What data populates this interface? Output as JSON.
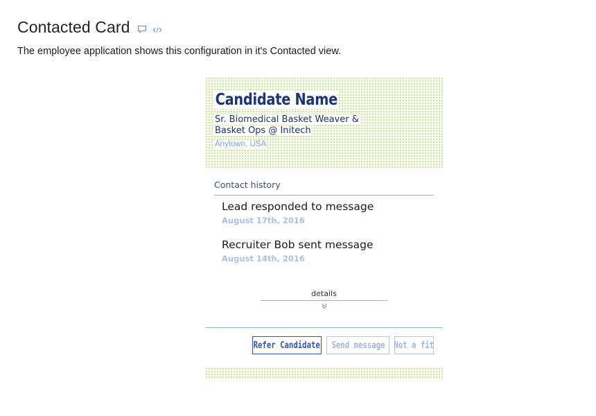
{
  "header": {
    "title": "Contacted Card",
    "comment_icon": "speech-bubble-icon",
    "code_icon": "code-brackets-icon"
  },
  "description": "The employee application shows this configuration in it's Contacted view.",
  "card": {
    "candidate_name": "Candidate Name",
    "candidate_title": "Sr. Biomedical Basket Weaver & Basket Ops @ Initech",
    "candidate_location": "Anytown, USA",
    "history_label": "Contact history",
    "events": [
      {
        "text": "Lead responded to message",
        "date": "August 17th, 2016"
      },
      {
        "text": "Recruiter Bob sent message",
        "date": "August 14th, 2016"
      }
    ],
    "details_label": "details",
    "details_icon": "double-chevron-down-icon",
    "actions": {
      "refer": "Refer Candidate",
      "send": "Send message",
      "not_fit": "Not a fit"
    }
  },
  "colors": {
    "accent": "#2c55c0",
    "name_text": "#1a3478",
    "muted_blue": "#a9c1ea",
    "rule": "#8fb0e6",
    "dot_pattern": "#c4d97f"
  }
}
